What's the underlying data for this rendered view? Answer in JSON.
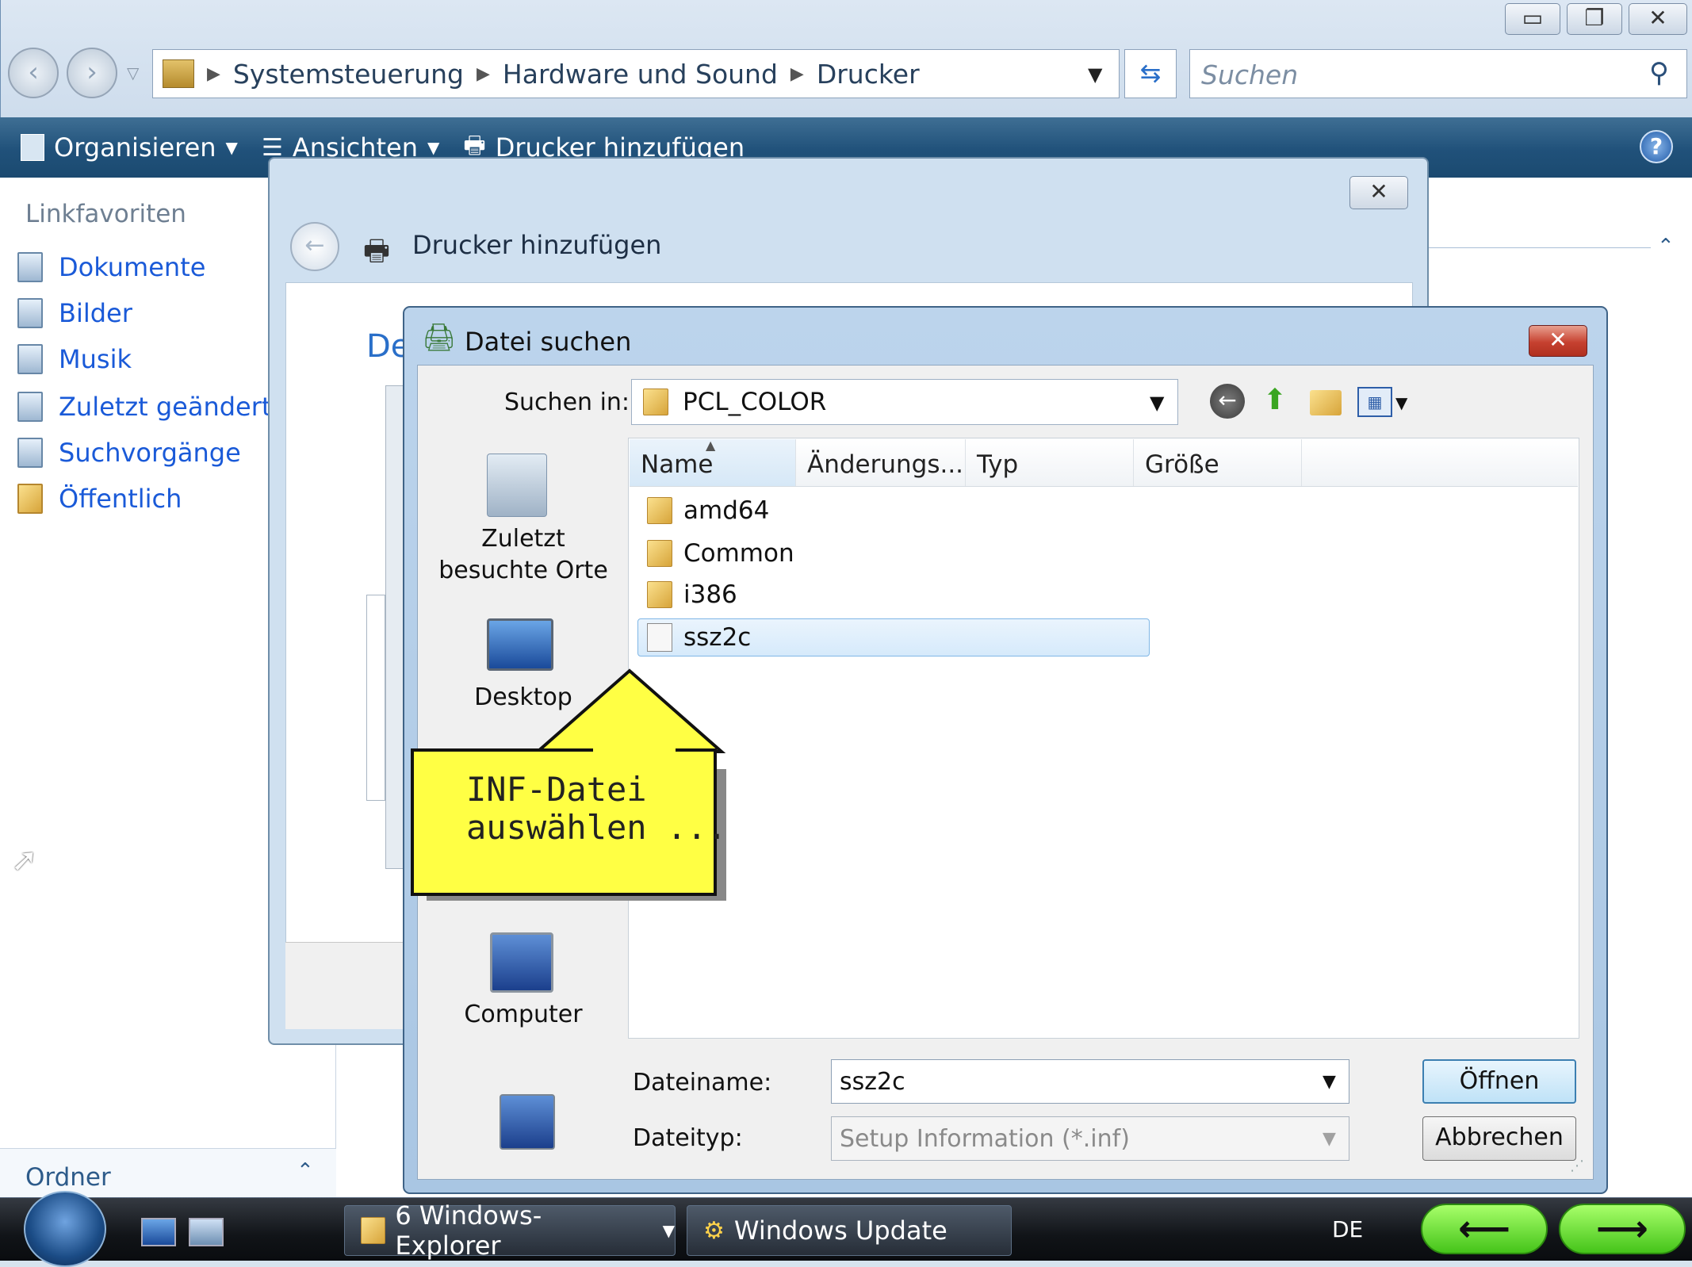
{
  "explorer": {
    "breadcrumb": [
      "Systemsteuerung",
      "Hardware und Sound",
      "Drucker"
    ],
    "search_placeholder": "Suchen",
    "toolbar": {
      "organize": "Organisieren",
      "views": "Ansichten",
      "add_printer": "Drucker hinzufügen"
    },
    "linkfav_label": "Linkfavoriten",
    "favorites": [
      "Dokumente",
      "Bilder",
      "Musik",
      "Zuletzt geändert",
      "Suchvorgänge",
      "Öffentlich"
    ],
    "folders_label": "Ordner"
  },
  "wizard": {
    "title": "Drucker hinzufügen",
    "heading_fragment": "De"
  },
  "dialog": {
    "title": "Datei suchen",
    "look_in_label": "Suchen in:",
    "look_in_value": "PCL_COLOR",
    "places": [
      {
        "line1": "Zuletzt",
        "line2": "besuchte Orte"
      },
      {
        "line1": "Desktop"
      },
      {
        "line1": "Computer"
      }
    ],
    "columns": [
      "Name",
      "Änderungs...",
      "Typ",
      "Größe"
    ],
    "files": [
      {
        "name": "amd64",
        "kind": "folder"
      },
      {
        "name": "Common",
        "kind": "folder"
      },
      {
        "name": "i386",
        "kind": "folder"
      },
      {
        "name": "ssz2c",
        "kind": "file",
        "selected": true
      }
    ],
    "filename_label": "Dateiname:",
    "filename_value": "ssz2c",
    "filetype_label": "Dateityp:",
    "filetype_value": "Setup Information (*.inf)",
    "open_button": "Öffnen",
    "cancel_button": "Abbrechen"
  },
  "callout": {
    "line1": "INF-Datei",
    "line2": "auswählen ..."
  },
  "taskbar": {
    "explorer_group": "6 Windows-Explorer",
    "update": "Windows Update",
    "lang": "DE"
  },
  "colors": {
    "callout_fill": "#ffff44",
    "toolbar": "#20517a",
    "link": "#1a5ad8"
  }
}
